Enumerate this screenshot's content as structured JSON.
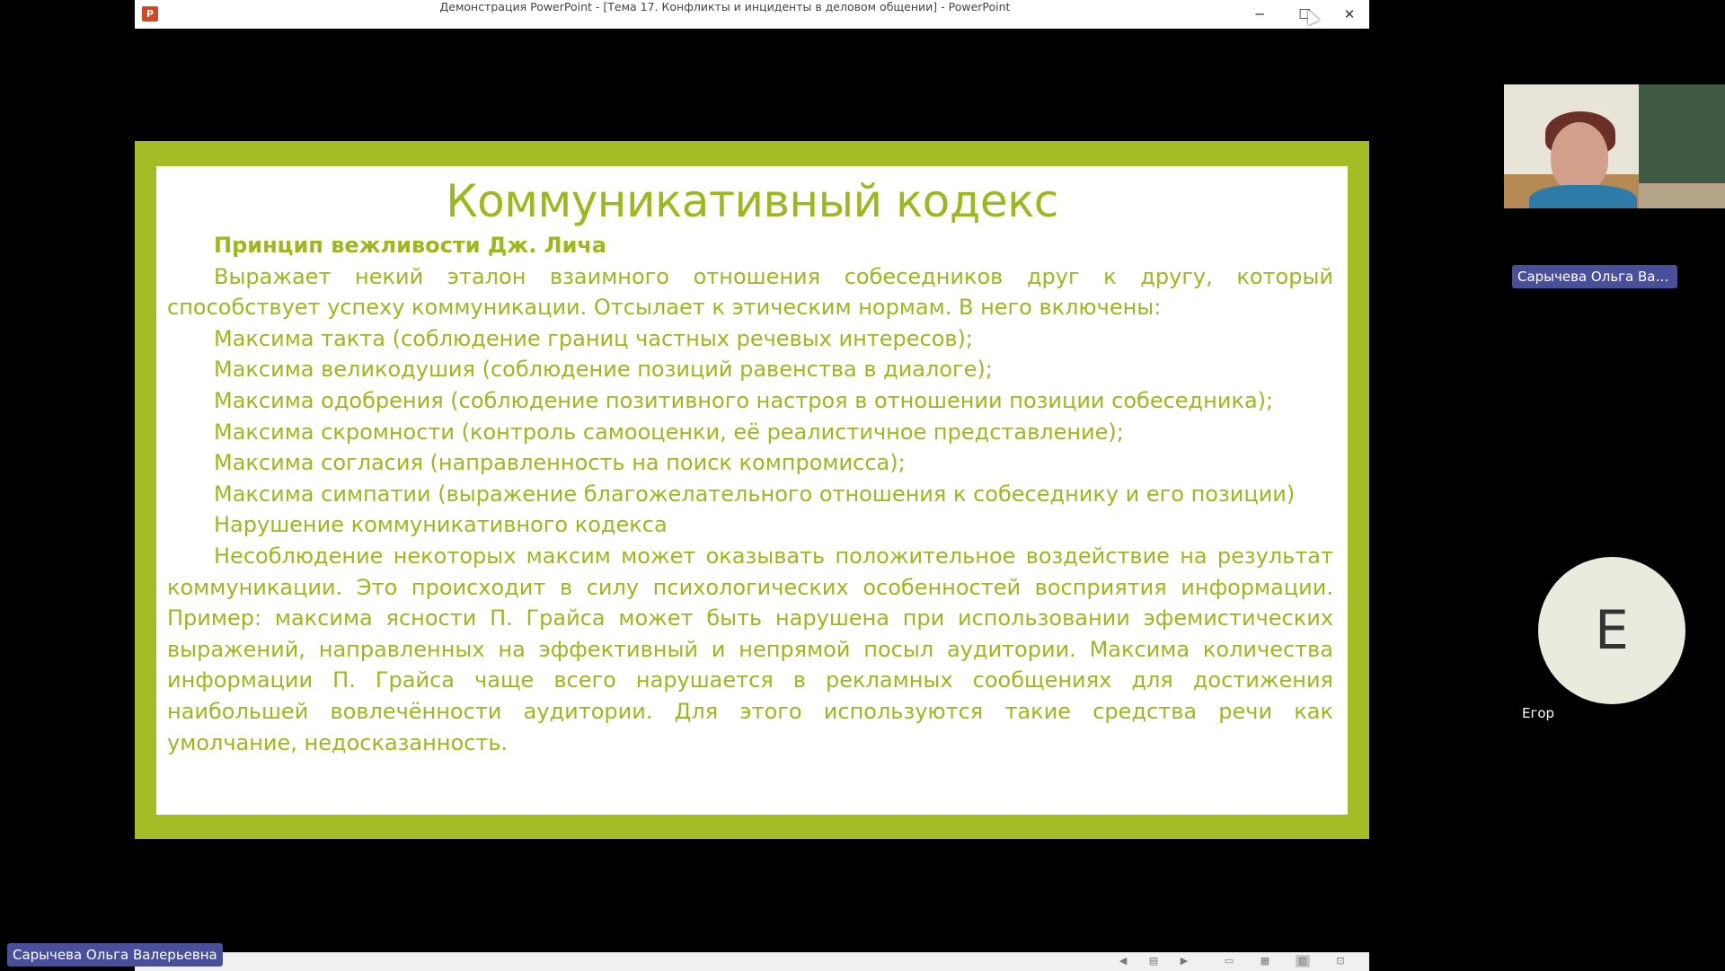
{
  "window": {
    "title": "Демонстрация PowerPoint - [Тема  17. Конфликты и инциденты в деловом общении] - PowerPoint",
    "app_icon": "powerpoint-icon",
    "app_icon_letter": "P",
    "minimize_glyph": "─",
    "maximize_glyph": "☐",
    "close_glyph": "✕"
  },
  "slide": {
    "title": "Коммуникативный кодекс",
    "subheading": "Принцип вежливости Дж. Лича",
    "intro": "Выражает некий эталон взаимного отношения собеседников друг к другу, который способствует успеху коммуникации. Отсылает к этическим нормам. В него включены:",
    "maxims": [
      "Максима такта (соблюдение границ частных речевых интересов);",
      "Максима великодушия (соблюдение позиций равенства в диалоге);",
      "Максима одобрения (соблюдение позитивного настроя в отношении позиции собеседника);",
      "Максима скромности (контроль самооценки, её реалистичное представление);",
      "Максима согласия (направленность на поиск компромисса);",
      "Максима симпатии (выражение благожелательного отношения к собеседнику и его позиции)"
    ],
    "violation_heading": "Нарушение коммуникативного кодекса",
    "violation_text": "Несоблюдение некоторых максим может оказывать положительное воздействие на результат коммуникации. Это происходит в силу психологических особенностей восприятия информации. Пример: максима ясности П. Грайса может быть нарушена при использовании эфемистических выражений, направленных на эффективный и непрямой посыл аудитории. Максима количества информации П. Грайса чаще всего нарушается в рекламных сообщениях для достижения наибольшей вовлечённости аудитории. Для этого используются такие средства речи как умолчание, недосказанность."
  },
  "statusbar": {
    "icons": [
      "prev-slide-icon",
      "slide-menu-icon",
      "next-slide-icon",
      "normal-view-icon",
      "slide-sorter-icon",
      "reading-view-icon",
      "slideshow-icon"
    ],
    "glyphs": [
      "◀",
      "▤",
      "▶",
      "▭",
      "▦",
      "▥",
      "⊡"
    ]
  },
  "participants": {
    "presenter_name": "Сарычева Ольга Валерье...",
    "presenter_name_full": "Сарычева Ольга Валерьевна",
    "guest_initial": "Е",
    "guest_name": "Егор"
  },
  "colors": {
    "slide_border": "#a4bc25",
    "slide_text": "#9cb81f",
    "name_tag_bg": "#4a4f9c"
  }
}
